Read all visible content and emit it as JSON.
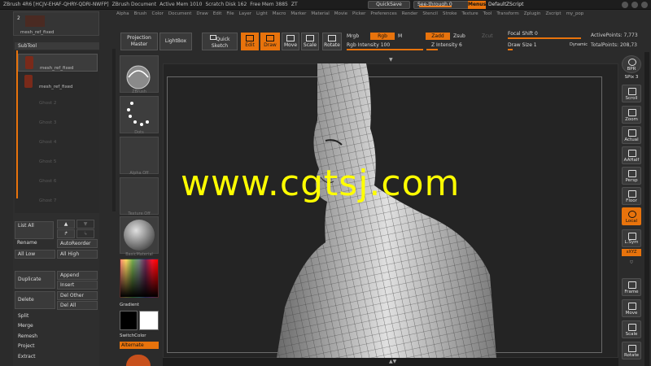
{
  "title_bar": {
    "app_title": "ZBrush 4R6 [HCJV-EHAF-QHRY-QDRI-NWFP]",
    "document": "ZBrush Document",
    "active_mem": "Active Mem 1010",
    "scratch_disk": "Scratch Disk 162",
    "free_mem": "Free Mem 3885",
    "zt": "ZT",
    "quicksave": "QuickSave",
    "see_through": "See-through 0",
    "see_through_level": 0,
    "menus": "Menus",
    "default_script": "DefaultZScript"
  },
  "menubar": [
    "Alpha",
    "Brush",
    "Color",
    "Document",
    "Draw",
    "Edit",
    "File",
    "Layer",
    "Light",
    "Macro",
    "Marker",
    "Material",
    "Movie",
    "Picker",
    "Preferences",
    "Render",
    "Stencil",
    "Stroke",
    "Texture",
    "Tool",
    "Transform",
    "Zplugin",
    "Zscript",
    "my_pop"
  ],
  "toolbar": {
    "projection_master": "Projection Master",
    "lightbox": "LightBox",
    "quick_sketch": "Quick Sketch",
    "edit": "Edit",
    "draw": "Draw",
    "move": "Move",
    "scale": "Scale",
    "rotate": "Rotate",
    "mrgb": "Mrgb",
    "rgb": "Rgb",
    "m": "M",
    "zadd": "Zadd",
    "zsub": "Zsub",
    "zcut": "Zcut",
    "rgb_intensity": "Rgb Intensity 100",
    "z_intensity": "Z Intensity 6",
    "focal_shift": "Focal Shift 0",
    "draw_size": "Draw Size 1",
    "dynamic": "Dynamic",
    "active_points": "ActivePoints: 7,773",
    "total_points": "TotalPoints: 208,73"
  },
  "left_panel": {
    "top_number": "2",
    "top_name": "mesh_ref_fixed",
    "subtool_header": "SubTool",
    "subtools": [
      {
        "name": "mesh_ref_fixed"
      },
      {
        "name": "mesh_ref_fixed"
      }
    ],
    "ghosts": [
      "Ghost 2",
      "Ghost 3",
      "Ghost 4",
      "Ghost 5",
      "Ghost 6",
      "Ghost 7"
    ],
    "list_all": "List All",
    "rename": "Rename",
    "auto_reorder": "AutoReorder",
    "all_low": "All Low",
    "all_high": "All High",
    "duplicate": "Duplicate",
    "append": "Append",
    "insert": "Insert",
    "delete": "Delete",
    "del_other": "Del Other",
    "del_all": "Del All",
    "split": "Split",
    "merge": "Merge",
    "remesh": "Remesh",
    "project": "Project",
    "extract": "Extract"
  },
  "tool_column": {
    "brush_label": "ZBrush",
    "dots_label": "Dots",
    "alpha_label": "Alpha Off",
    "texture_label": "Texture Off",
    "material_label": "BasicMaterial",
    "gradient": "Gradient",
    "switch_color": "SwitchColor",
    "alternate": "Alternate"
  },
  "canvas": {
    "watermark": "www.cgtsj.com"
  },
  "right_shelf": {
    "bpr": "BPR",
    "spix": "SPix 3",
    "scroll": "Scroll",
    "zoom": "Zoom",
    "actual": "Actual",
    "aahalf": "AAHalf",
    "persp": "Persp",
    "floor": "Floor",
    "local": "Local",
    "lsym": "L.Sym",
    "xyz": "xXYZ",
    "frame": "Frame",
    "move": "Move",
    "scale": "Scale",
    "rotate": "Rotate"
  },
  "colors": {
    "accent": "#e8730c",
    "panel": "#2e2e2e",
    "canvas": "#242424",
    "watermark": "#ffff00"
  }
}
